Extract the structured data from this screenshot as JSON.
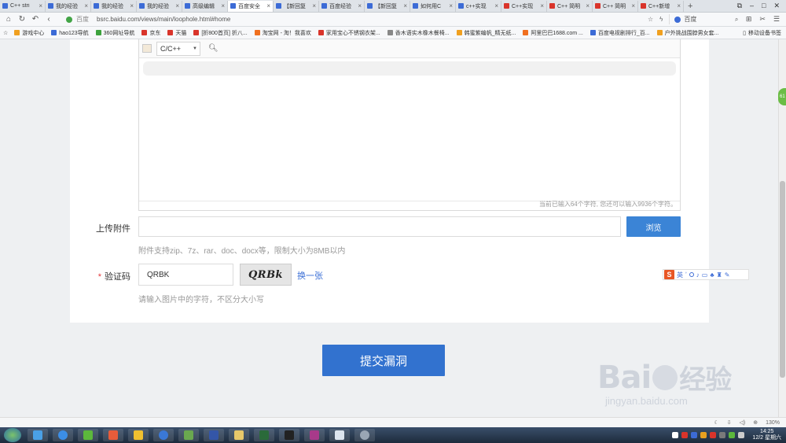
{
  "browser": {
    "tabs": [
      {
        "title": "C++ stri",
        "color": "#3c6bd6",
        "active": false
      },
      {
        "title": "我的经验",
        "color": "#3c6bd6",
        "active": false
      },
      {
        "title": "我的经验",
        "color": "#3c6bd6",
        "active": false
      },
      {
        "title": "我的经验",
        "color": "#3c6bd6",
        "active": false
      },
      {
        "title": "高级编辑",
        "color": "#3c6bd6",
        "active": false
      },
      {
        "title": "百度安全",
        "color": "#3c6bd6",
        "active": true
      },
      {
        "title": "【新回复",
        "color": "#3c6bd6",
        "active": false
      },
      {
        "title": "百度经验",
        "color": "#3c6bd6",
        "active": false
      },
      {
        "title": "【新回复",
        "color": "#3c6bd6",
        "active": false
      },
      {
        "title": "如何用C",
        "color": "#3c6bd6",
        "active": false
      },
      {
        "title": "c++实现",
        "color": "#3c6bd6",
        "active": false
      },
      {
        "title": "C++实现",
        "color": "#d9342b",
        "active": false
      },
      {
        "title": "C++ 简明",
        "color": "#d9342b",
        "active": false
      },
      {
        "title": "C++ 简明",
        "color": "#d9342b",
        "active": false
      },
      {
        "title": "C++新增",
        "color": "#d9342b",
        "active": false
      }
    ],
    "new_tab": "+",
    "site_name": "百度",
    "url": "bsrc.baidu.com/views/main/loophole.html#home",
    "search_engine": "百度",
    "zoom": "130%",
    "bookmarks": [
      {
        "label": "游戏中心",
        "color": "#f0a020"
      },
      {
        "label": "hao123导航",
        "color": "#3c6bd6"
      },
      {
        "label": "360网址导航",
        "color": "#3da23d"
      },
      {
        "label": "京东",
        "color": "#d9342b"
      },
      {
        "label": "天猫",
        "color": "#d9342b"
      },
      {
        "label": "[折800首页] 折八...",
        "color": "#d9342b"
      },
      {
        "label": "淘宝网 - 淘！我喜欢",
        "color": "#f07020"
      },
      {
        "label": "家用宝心不锈钢衣架...",
        "color": "#d9342b"
      },
      {
        "label": "香木语实木橡木餐椅...",
        "color": "#888888"
      },
      {
        "label": "韩蜜紫编帆_精无纸...",
        "color": "#f0a020"
      },
      {
        "label": "阿里巴巴1688.com ...",
        "color": "#f07020"
      },
      {
        "label": "百度电视剧排行_百...",
        "color": "#3c6bd6"
      },
      {
        "label": "户外挑战围脖男女套...",
        "color": "#f0a020"
      }
    ],
    "mobile_bookmarks": "移动设备书签"
  },
  "form": {
    "language_select": "C/C++",
    "char_count": "当前已输入64个字符, 您还可以输入9936个字符。",
    "attachment_label": "上传附件",
    "browse_button": "浏览",
    "attachment_hint": "附件支持zip、7z、rar、doc、docx等，限制大小为8MB以内",
    "captcha_required": "*",
    "captcha_label": "验证码",
    "captcha_value": "QRBK",
    "captcha_image_text": "QRBk",
    "captcha_refresh": "换一张",
    "captcha_hint": "请输入图片中的字符，不区分大小写",
    "submit_button": "提交漏洞"
  },
  "ime": {
    "logo": "S",
    "mode": "英"
  },
  "side_badge": "61",
  "watermark": {
    "main_left": "Bai",
    "main_right": "经验",
    "sub": "jingyan.baidu.com"
  },
  "taskbar": {
    "time": "14:25",
    "date": "12/2 星期六"
  }
}
